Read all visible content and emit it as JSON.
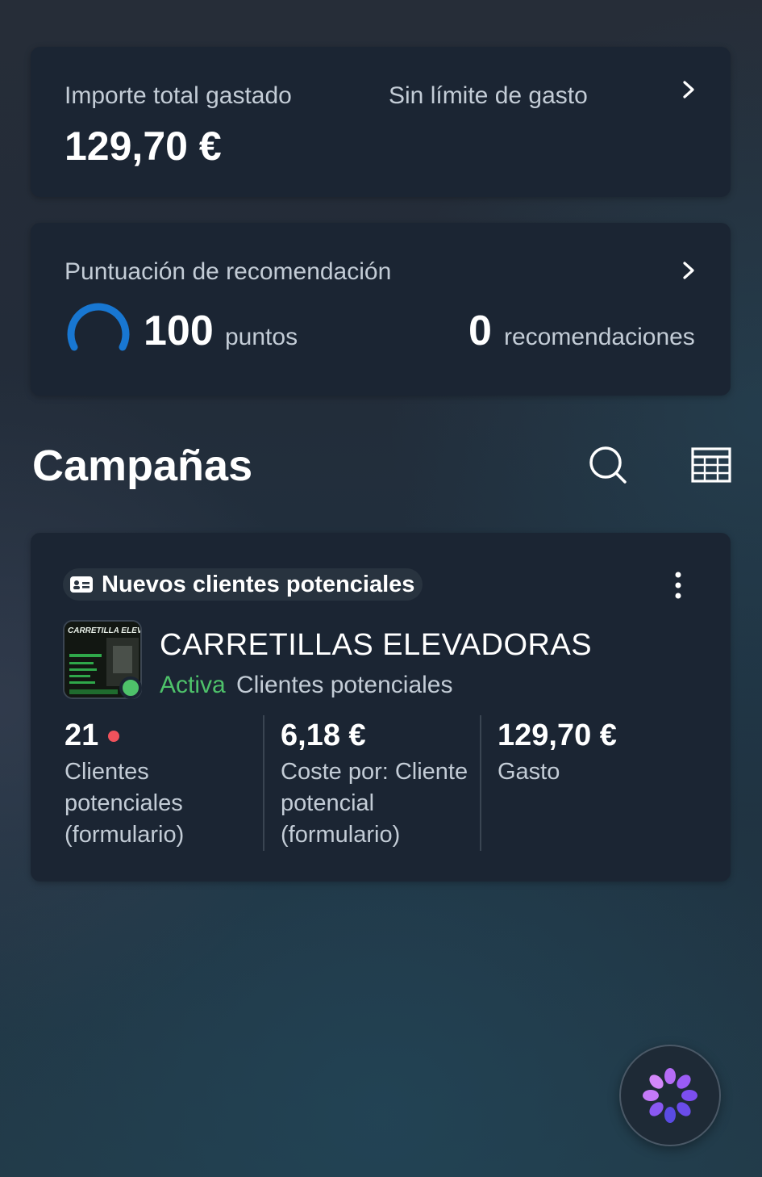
{
  "spend": {
    "label": "Importe total gastado",
    "value": "129,70 €",
    "limit_label": "Sin límite de gasto"
  },
  "score": {
    "label": "Puntuación de recomendación",
    "value": "100",
    "unit": "puntos",
    "recommendations_value": "0",
    "recommendations_unit": "recomendaciones",
    "ring_level": 0.9
  },
  "campaigns": {
    "title": "Campañas",
    "items": [
      {
        "objective": "Nuevos clientes potenciales",
        "name": "CARRETILLAS ELEVADORAS",
        "status": "Activa",
        "result_type": "Clientes potenciales",
        "thumbnail_text": "CARRETILLA ELEVADORA?",
        "metrics": [
          {
            "value": "21",
            "label": "Clientes potenciales (formulario)"
          },
          {
            "value": "6,18 €",
            "label": "Coste por: Cliente potencial (formulario)"
          },
          {
            "value": "129,70 €",
            "label": "Gasto"
          }
        ]
      }
    ]
  },
  "icons": {
    "chevron": "chevron-right-icon",
    "search": "search-icon",
    "table": "table-icon",
    "objective": "lead-card-icon",
    "more": "more-vertical-icon",
    "fab": "ai-assistant-icon"
  },
  "colors": {
    "card_bg": "#1b2533",
    "active_green": "#4ec26a",
    "ring_blue": "#1877d2",
    "alert_red": "#f0525c",
    "fab_purple": "#9b5cf5"
  }
}
